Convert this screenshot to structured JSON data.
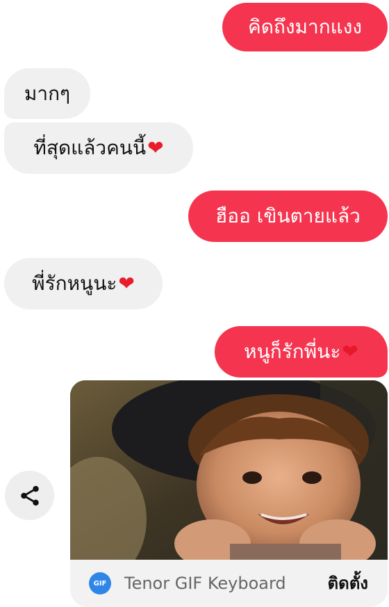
{
  "messages": [
    {
      "id": "b1",
      "direction": "outgoing",
      "text": "คิดถึงมากแงง"
    },
    {
      "id": "b2",
      "direction": "incoming",
      "text": "มากๆ"
    },
    {
      "id": "b3",
      "direction": "incoming",
      "text": "ที่สุดแล้วคนนี้",
      "emoji": "❤"
    },
    {
      "id": "b4",
      "direction": "outgoing",
      "text": "ฮืออ เขินตายแล้ว"
    },
    {
      "id": "b5",
      "direction": "incoming",
      "text": "พี่รักหนูนะ",
      "emoji": "❤"
    },
    {
      "id": "b6",
      "direction": "outgoing",
      "text": "หนูก็รักพี่นะ",
      "emoji": "❤"
    }
  ],
  "gif": {
    "badge": "GIF",
    "source_label": "Tenor GIF Keyboard",
    "install_label": "ติดตั้ง"
  },
  "icons": {
    "share": "share-icon",
    "heart": "heart-emoji"
  },
  "colors": {
    "outgoing_bubble": "#f5344f",
    "incoming_bubble": "#f0f0f0",
    "tenor_badge": "#2f86e8"
  }
}
